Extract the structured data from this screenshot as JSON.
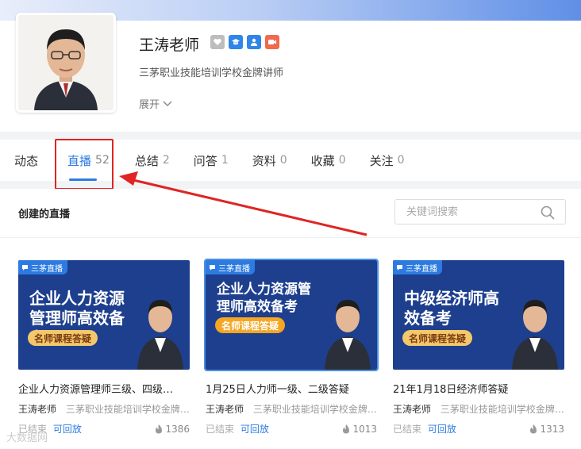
{
  "profile": {
    "name": "王涛老师",
    "subtitle": "三茅职业技能培训学校金牌讲师",
    "expand_label": "展开",
    "badge_colors": [
      "#b9b9b9",
      "#2f86e8",
      "#2f86e8",
      "#f06a4d"
    ]
  },
  "tabs": [
    {
      "label": "动态",
      "count": ""
    },
    {
      "label": "直播",
      "count": "52",
      "active": true
    },
    {
      "label": "总结",
      "count": "2"
    },
    {
      "label": "问答",
      "count": "1"
    },
    {
      "label": "资料",
      "count": "0"
    },
    {
      "label": "收藏",
      "count": "0"
    },
    {
      "label": "关注",
      "count": "0"
    }
  ],
  "panel": {
    "title": "创建的直播",
    "search_placeholder": "关键词搜索"
  },
  "cards": [
    {
      "tag": "三茅直播",
      "thumb_headline": "企业人力资源管理师高效备考",
      "thumb_sub": "名师课程答疑",
      "title": "企业人力资源管理师三级、四级…",
      "author": "王涛老师",
      "school": "三茅职业技能培训学校金牌…",
      "status": "已结束",
      "replay": "可回放",
      "views": "1386"
    },
    {
      "tag": "三茅直播",
      "thumb_headline": "企业人力资源管理师高效备考",
      "thumb_sub": "名师课程答疑",
      "title": "1月25日人力师一级、二级答疑",
      "author": "王涛老师",
      "school": "三茅职业技能培训学校金牌…",
      "status": "已结束",
      "replay": "可回放",
      "views": "1013"
    },
    {
      "tag": "三茅直播",
      "thumb_headline": "中级经济师高效备考",
      "thumb_sub": "名师课程答疑",
      "title": "21年1月18日经济师答疑",
      "author": "王涛老师",
      "school": "三茅职业技能培训学校金牌…",
      "status": "已结束",
      "replay": "可回放",
      "views": "1313"
    }
  ],
  "corner_watermark": "大数据网"
}
